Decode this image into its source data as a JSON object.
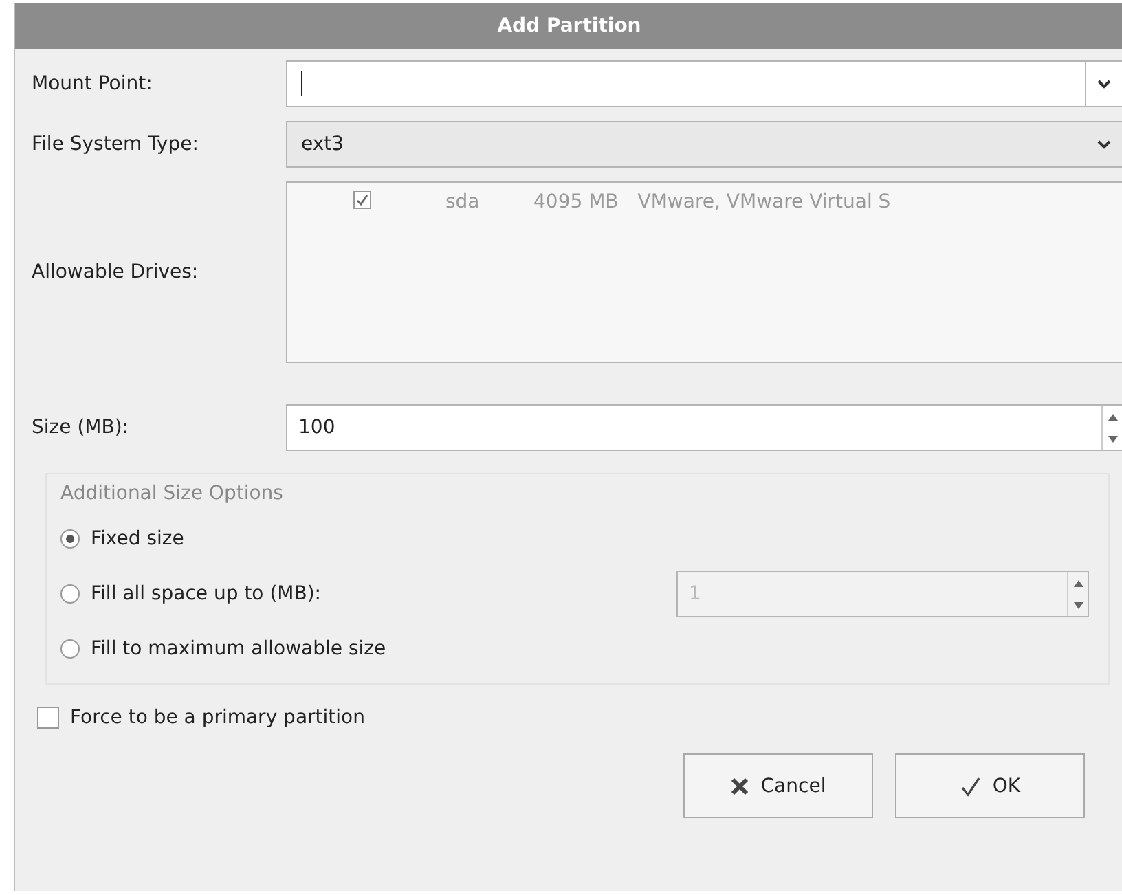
{
  "window": {
    "title": "Add Partition"
  },
  "mount_point": {
    "label": "Mount Point:"
  },
  "file_system_type": {
    "label": "File System Type:",
    "value": "ext3"
  },
  "allowable_drives": {
    "label": "Allowable Drives:",
    "drives": [
      {
        "checked": true,
        "name": "sda",
        "size": "4095 MB",
        "model": "VMware, VMware Virtual S"
      }
    ]
  },
  "size": {
    "label": "Size (MB):",
    "value": "100"
  },
  "size_options": {
    "title": "Additional Size Options",
    "options": [
      {
        "label": "Fixed size",
        "selected": true
      },
      {
        "label": "Fill all space up to (MB):",
        "selected": false,
        "value": "1",
        "disabled": true
      },
      {
        "label": "Fill to maximum allowable size",
        "selected": false
      }
    ]
  },
  "force_primary": {
    "label": "Force to be a primary partition",
    "checked": false
  },
  "buttons": [
    {
      "kind": "cancel",
      "label": "Cancel"
    },
    {
      "kind": "ok",
      "label": "OK"
    }
  ]
}
